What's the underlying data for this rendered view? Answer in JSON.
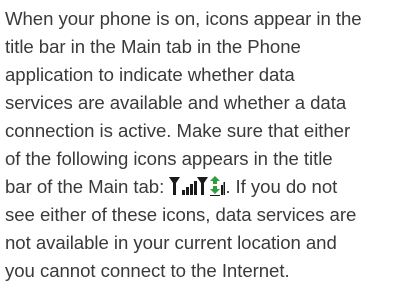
{
  "paragraph": {
    "lines": [
      "When your phone is on, icons appear in the",
      "title bar in the Main tab in the Phone",
      "application to indicate whether data",
      "services are available and whether a data",
      "connection is active. Make sure that either",
      "of the following icons appears in the title",
      "bar of the Main tab: ",
      ". If you do not",
      "see either of these icons, data services are",
      "not available in your current location and",
      "you cannot connect to the Internet."
    ]
  },
  "icons": {
    "first": "data-service-available-icon",
    "second": "data-connection-active-icon",
    "arrow_up_color": "#2e9e3a",
    "arrow_down_color": "#2e9e3a"
  }
}
